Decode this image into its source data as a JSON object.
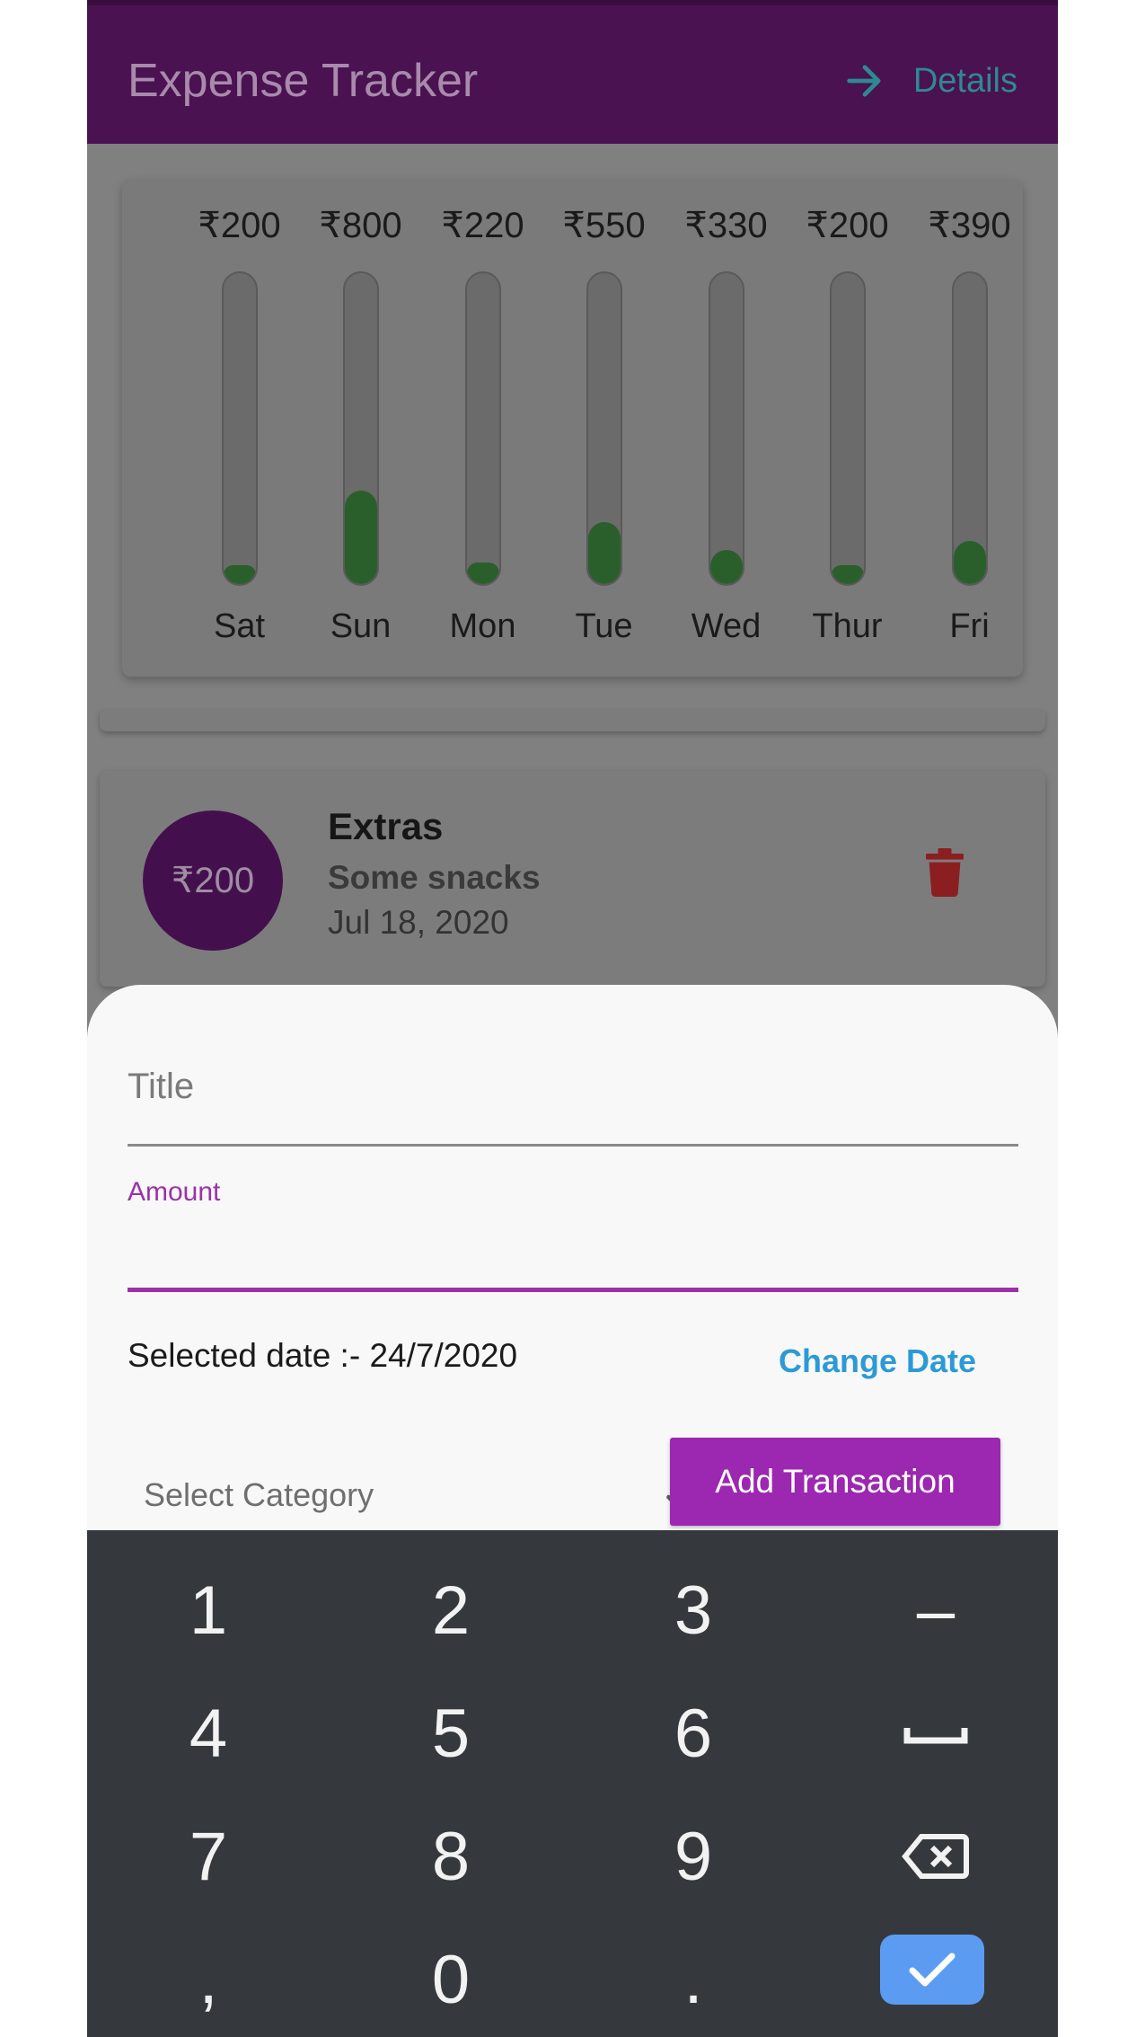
{
  "app_bar": {
    "title": "Expense Tracker",
    "details_label": "Details",
    "details_icon": "arrow-right-icon"
  },
  "weekly_chart": {
    "bars": [
      {
        "day": "Sat",
        "amount": "₹200",
        "fill_fraction": 0.06
      },
      {
        "day": "Sun",
        "amount": "₹800",
        "fill_fraction": 0.3
      },
      {
        "day": "Mon",
        "amount": "₹220",
        "fill_fraction": 0.07
      },
      {
        "day": "Tue",
        "amount": "₹550",
        "fill_fraction": 0.2
      },
      {
        "day": "Wed",
        "amount": "₹330",
        "fill_fraction": 0.11
      },
      {
        "day": "Thur",
        "amount": "₹200",
        "fill_fraction": 0.06
      },
      {
        "day": "Fri",
        "amount": "₹390",
        "fill_fraction": 0.14
      }
    ],
    "fill_color": "#2a5f2c"
  },
  "transaction": {
    "amount": "₹200",
    "title": "Extras",
    "subtitle": "Some snacks",
    "date": "Jul 18, 2020",
    "delete_icon": "trash-icon"
  },
  "form": {
    "title_placeholder": "Title",
    "amount_label": "Amount",
    "selected_date": "Selected date :- 24/7/2020",
    "change_date_label": "Change Date",
    "category_placeholder": "Select Category",
    "add_button_label": "Add Transaction",
    "accent_color": "#9c27b0"
  },
  "keyboard": {
    "keys": [
      "1",
      "2",
      "3",
      "–",
      "4",
      "5",
      "6",
      "␣",
      "7",
      "8",
      "9",
      "⌫",
      ",",
      "0",
      ".",
      "✓"
    ]
  }
}
